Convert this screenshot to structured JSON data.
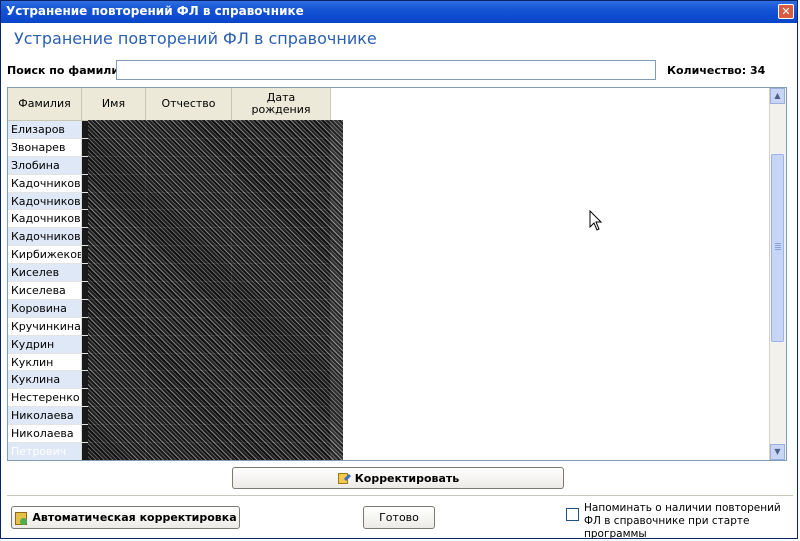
{
  "window": {
    "title": "Устранение повторений ФЛ в справочнике",
    "close_glyph": "✕"
  },
  "heading": "Устранение повторений ФЛ в справочнике",
  "search": {
    "label": "Поиск по фамилии:",
    "value": "",
    "placeholder": ""
  },
  "count_label": "Количество: 34",
  "table": {
    "columns": [
      "Фамилия",
      "Имя",
      "Отчество",
      "Дата рождения"
    ],
    "column_lines": [
      [
        "Фамилия"
      ],
      [
        "Имя"
      ],
      [
        "Отчество"
      ],
      [
        "Дата",
        "рождения"
      ]
    ],
    "rows": [
      "Елизаров",
      "Звонарев",
      "Злобина",
      "Кадочников",
      "Кадочников",
      "Кадочникова",
      "Кадочникова",
      "Кирбижеков",
      "Киселев",
      "Киселева",
      "Коровина",
      "Кручинкина",
      "Кудрин",
      "Куклин",
      "Куклина",
      "Нестеренко",
      "Николаева",
      "Николаева",
      "Петрович"
    ],
    "selected_index": 18
  },
  "buttons": {
    "correct": "Корректировать",
    "auto_correct": "Автоматическая корректировка",
    "done": "Готово"
  },
  "remind_checkbox": {
    "label": "Напоминать о наличии повторений ФЛ в справочнике при старте программы",
    "checked": false
  },
  "icons": {
    "close": "close-icon",
    "correct": "edit-icon",
    "auto": "auto-correct-icon",
    "scroll_up": "arrow-up-icon",
    "scroll_down": "arrow-down-icon",
    "cursor": "mouse-cursor-icon"
  }
}
